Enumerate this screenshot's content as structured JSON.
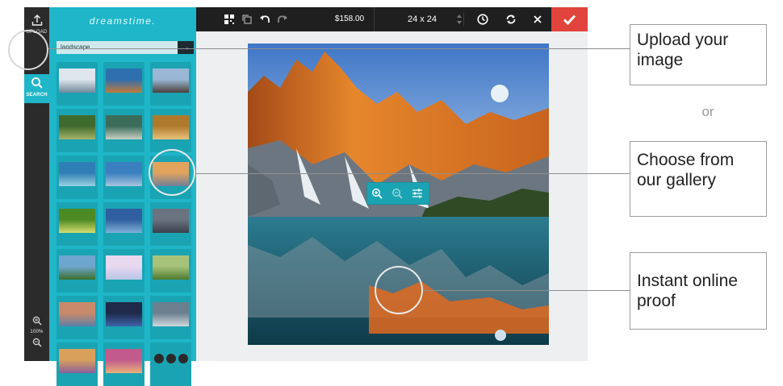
{
  "brand": {
    "logo": "dreamstime."
  },
  "rail": {
    "upload_label": "UPLOAD",
    "search_label": "SEARCH",
    "zoom_level": "100%"
  },
  "search": {
    "value": "landscape",
    "go_icon": "arrow-right-icon"
  },
  "toolbar": {
    "price": "$158.00",
    "size": "24 x 24",
    "icons": [
      "qr-grid-icon",
      "copy-icon",
      "undo-icon",
      "redo-icon",
      "stepper-icon",
      "clock-icon",
      "refresh-icon",
      "close-icon",
      "check-icon"
    ]
  },
  "photo_overlay": {
    "icons": [
      "zoom-in-icon",
      "zoom-out-icon",
      "adjust-icon"
    ]
  },
  "callouts": {
    "upload": "Upload your image",
    "or": "or",
    "gallery": "Choose from our gallery",
    "proof": "Instant online proof"
  },
  "gallery_thumbs": [
    [
      "#dfe6ee",
      "#6f8a9c"
    ],
    [
      "#2e6fb0",
      "#c47a3a"
    ],
    [
      "#9bb7d6",
      "#4b3f3a"
    ],
    [
      "#3f6a2e",
      "#a8b468"
    ],
    [
      "#3c6d5a",
      "#c9d0c4"
    ],
    [
      "#b07a2c",
      "#e8c17a"
    ],
    [
      "#2f7fb6",
      "#9ad1e0"
    ],
    [
      "#3a7fbf",
      "#a9c5df"
    ],
    [
      "#e2a35c",
      "#6f7f9c"
    ],
    [
      "#4c8a23",
      "#d7dc72"
    ],
    [
      "#2f5fa0",
      "#7fb0d8"
    ],
    [
      "#6a7380",
      "#3a404a"
    ],
    [
      "#6fa6cf",
      "#3c6f2e"
    ],
    [
      "#e8d8f0",
      "#b6c6e6"
    ],
    [
      "#a7c37a",
      "#4f7a2e"
    ],
    [
      "#c88a6a",
      "#5e7fa8"
    ],
    [
      "#1f2a4a",
      "#3e63a8"
    ],
    [
      "#6b7f8f",
      "#cfd8de"
    ],
    [
      "#d9a05c",
      "#8a5f9c"
    ],
    [
      "#c25a8e",
      "#e9b07a"
    ]
  ]
}
